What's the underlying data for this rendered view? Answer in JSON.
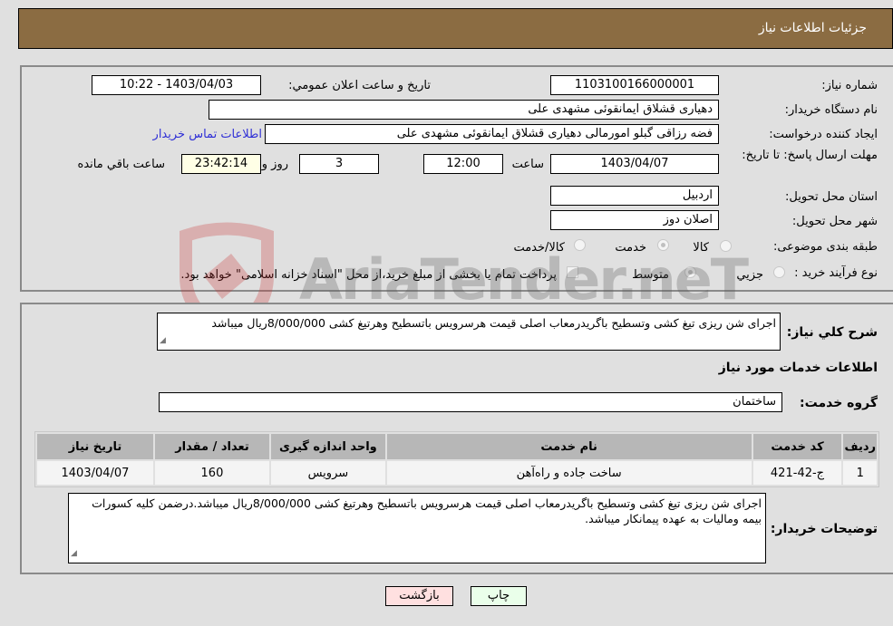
{
  "header": {
    "title": "جزئیات اطلاعات نیاز"
  },
  "details": {
    "need_number_label": "شماره نیاز:",
    "need_number": "1103100166000001",
    "announce_label": "تاريخ و ساعت اعلان عمومي:",
    "announce_value": "1403/04/03 - 10:22",
    "buyer_org_label": "نام دستگاه خريدار:",
    "buyer_org": "دهیاری قشلاق ایمانقوئی مشهدی علی",
    "creator_label": "ایجاد کننده درخواست:",
    "creator": "فضه رزاقی گبلو امورمالی دهیاری قشلاق ایمانقوئی مشهدی علی",
    "contact_link": "اطلاعات تماس خریدار",
    "deadline_label": "مهلت ارسال پاسخ: تا تاریخ:",
    "deadline_date": "1403/04/07",
    "time_label": "ساعت",
    "deadline_time": "12:00",
    "days_value": "3",
    "days_label": "روز و",
    "remaining_time": "23:42:14",
    "remaining_label": "ساعت باقي مانده",
    "province_label": "استان محل تحویل:",
    "province": "اردبیل",
    "city_label": "شهر محل تحویل:",
    "city": "اصلان دوز",
    "category_label": "طبقه بندی موضوعی:",
    "category_options": [
      {
        "label": "کالا",
        "selected": false
      },
      {
        "label": "خدمت",
        "selected": true
      },
      {
        "label": "کالا/خدمت",
        "selected": false
      }
    ],
    "process_label": "نوع فرآیند خرید :",
    "process_options": [
      {
        "label": "جزيي",
        "selected": false
      },
      {
        "label": "متوسط",
        "selected": true
      }
    ],
    "treasury_note": "پرداخت تمام یا بخشی از مبلغ خرید،از محل \"اسناد خزانه اسلامی\" خواهد بود.",
    "treasury_checked": false
  },
  "description": {
    "label": "شرح کلي نياز:",
    "text": "اجرای شن ریزی تیغ کشی وتسطیح باگریدرمعاب اصلی  قیمت هرسرویس باتسطیح وهرتیغ کشی 8/000/000ریال میباشد"
  },
  "services_section": {
    "title": "اطلاعات خدمات مورد نیاز",
    "group_label": "گروه خدمت:",
    "group_value": "ساختمان",
    "table": {
      "headers": [
        "ردیف",
        "کد خدمت",
        "نام خدمت",
        "واحد اندازه گیری",
        "تعداد / مقدار",
        "تاریخ نیاز"
      ],
      "rows": [
        [
          "1",
          "ج-42-421",
          "ساخت جاده و راه‌آهن",
          "سرویس",
          "160",
          "1403/04/07"
        ]
      ]
    }
  },
  "buyer_notes": {
    "label": "توضیحات خریدار:",
    "text": "اجرای شن ریزی تیغ کشی وتسطیح باگریدرمعاب اصلی  قیمت هرسرویس باتسطیح وهرتیغ کشی  8/000/000ریال میباشد.درضمن کلیه کسورات بیمه ومالیات به عهده پیمانکار میباشد."
  },
  "buttons": {
    "print": "چاپ",
    "back": "بازگشت"
  },
  "colors": {
    "header_bg": "#8b6c42",
    "print_bg": "#eaffea",
    "back_bg": "#ffe0e0",
    "link": "#2f2fd6"
  },
  "watermark": {
    "text": "AriaTender.neT"
  }
}
